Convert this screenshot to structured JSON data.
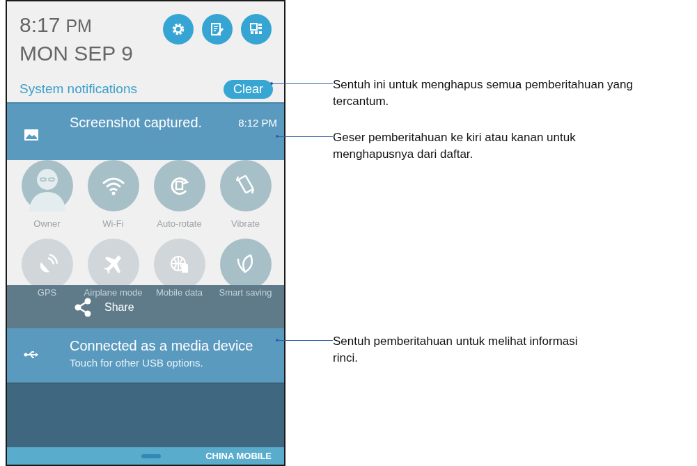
{
  "header": {
    "time": "8:17",
    "meridiem": "PM",
    "date": "MON SEP 9",
    "section_title": "System notifications",
    "clear_button": "Clear"
  },
  "notifications": [
    {
      "kind": "screenshot",
      "title": "Screenshot captured.",
      "time": "8:12 PM"
    },
    {
      "kind": "usb",
      "title": "Connected as a media device",
      "subtitle": "Touch for other USB options."
    }
  ],
  "quick_settings": [
    {
      "label": "Owner",
      "on": true
    },
    {
      "label": "Wi-Fi",
      "on": true
    },
    {
      "label": "Auto-rotate",
      "on": true
    },
    {
      "label": "Vibrate",
      "on": true
    },
    {
      "label": "GPS",
      "on": false
    },
    {
      "label": "Airplane mode",
      "on": false
    },
    {
      "label": "Mobile data",
      "on": false
    },
    {
      "label": "Smart saving",
      "on": true
    }
  ],
  "share_overlay": {
    "label": "Share"
  },
  "status_bar": {
    "carrier": "CHINA MOBILE"
  },
  "callouts": [
    "Sentuh ini untuk menghapus semua pemberitahuan yang tercantum.",
    "Geser pemberitahuan ke kiri atau kanan untuk menghapusnya dari daftar.",
    "Sentuh pemberitahuan untuk melihat informasi rinci."
  ]
}
